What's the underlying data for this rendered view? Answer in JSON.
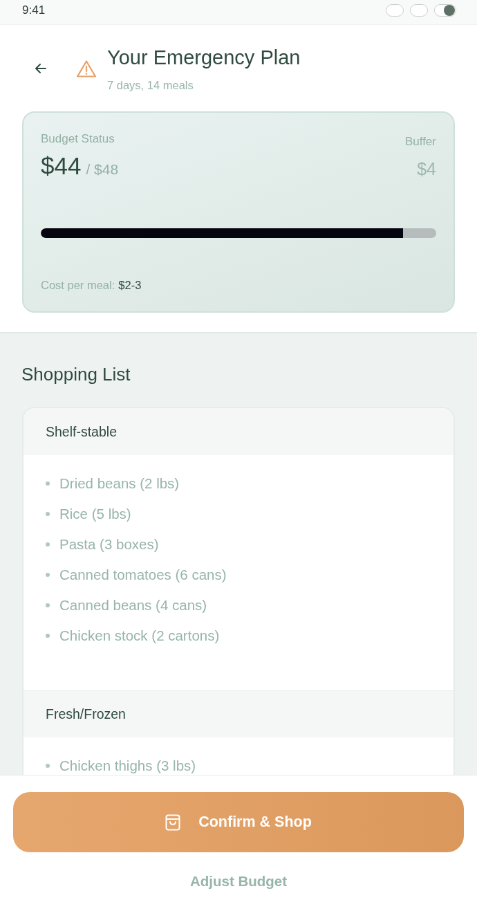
{
  "status_bar": {
    "time": "9:41"
  },
  "header": {
    "title": "Your Emergency Plan",
    "subtitle": "7 days, 14 meals"
  },
  "budget": {
    "label": "Budget Status",
    "spent": "$44",
    "total": "/ $48",
    "buffer_label": "Buffer",
    "buffer": "$4",
    "level": 0.916,
    "cost_label": "Cost per meal:",
    "cost_value": "$2-3"
  },
  "shopping_list": {
    "title": "Shopping List",
    "categories": [
      {
        "name": "Shelf-stable",
        "items": [
          "Dried beans (2 lbs)",
          "Rice (5 lbs)",
          "Pasta (3 boxes)",
          "Canned tomatoes (6 cans)",
          "Canned beans (4 cans)",
          "Chicken stock (2 cartons)"
        ]
      },
      {
        "name": "Fresh/Frozen",
        "items": [
          "Chicken thighs (3 lbs)"
        ]
      }
    ]
  },
  "actions": {
    "primary": "Confirm & Shop",
    "secondary": "Adjust Budget"
  }
}
